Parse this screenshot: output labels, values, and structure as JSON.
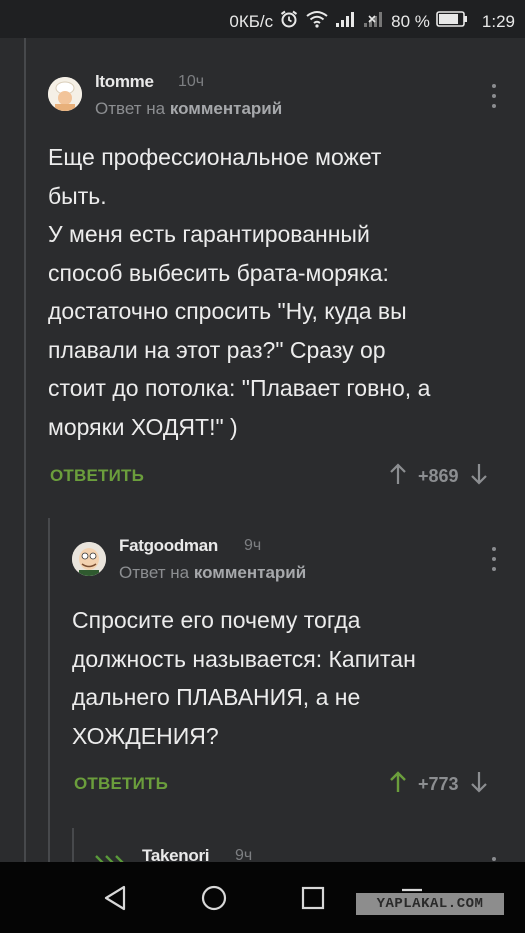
{
  "status_bar": {
    "network_speed": "0КБ/с",
    "battery": "80 %",
    "time": "1:29",
    "icons": [
      "alarm-icon",
      "wifi-icon",
      "signal-icon",
      "no-signal-icon",
      "battery-icon"
    ]
  },
  "comments": [
    {
      "author": "ltomme",
      "time": "10ч",
      "reply_prefix": "Ответ на",
      "reply_link": "комментарий",
      "text": "Еще профессиональное может\nбыть.\nУ меня есть гарантированный\nспособ выбесить брата-моряка:\nдостаточно спросить \"Ну, куда вы\nплавали на этот раз?\" Сразу ор\nстоит до потолка: \"Плавает говно, а\nморяки ХОДЯТ!\" )",
      "reply_label": "ОТВЕТИТЬ",
      "score": "+869"
    },
    {
      "author": "Fatgoodman",
      "time": "9ч",
      "reply_prefix": "Ответ на",
      "reply_link": "комментарий",
      "text": "Спросите его почему тогда\nдолжность называется: Капитан\nдальнего ПЛАВАНИЯ, а не\nХОЖДЕНИЯ?",
      "reply_label": "ОТВЕТИТЬ",
      "score": "+773"
    },
    {
      "author": "Takenori",
      "time": "9ч"
    }
  ],
  "watermark": "YAPLAKAL.COM",
  "colors": {
    "background": "#2b2c2e",
    "accent_green": "#6b9e3c",
    "upvoted_green": "#6b9e3c",
    "muted": "#8c8e91"
  }
}
